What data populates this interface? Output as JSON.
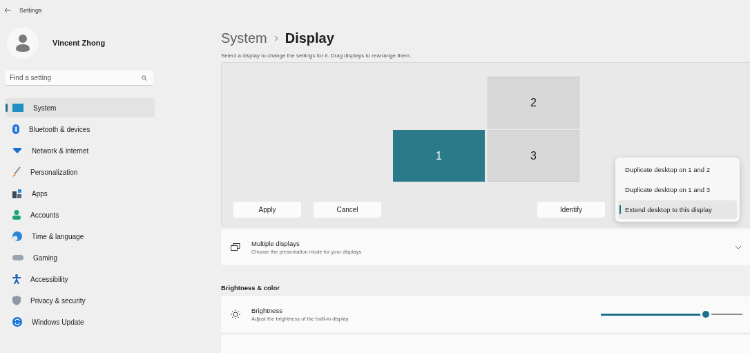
{
  "window": {
    "title": "Settings"
  },
  "profile": {
    "name": "Vincent Zhong"
  },
  "search": {
    "placeholder": "Find a setting"
  },
  "sidebar": {
    "items": [
      {
        "label": "System",
        "kind": "system",
        "selected": true
      },
      {
        "label": "Bluetooth & devices",
        "kind": "bluetooth",
        "selected": false
      },
      {
        "label": "Network & internet",
        "kind": "network",
        "selected": false
      },
      {
        "label": "Personalization",
        "kind": "brush",
        "selected": false
      },
      {
        "label": "Apps",
        "kind": "apps",
        "selected": false
      },
      {
        "label": "Accounts",
        "kind": "accounts",
        "selected": false
      },
      {
        "label": "Time & language",
        "kind": "time",
        "selected": false
      },
      {
        "label": "Gaming",
        "kind": "gaming",
        "selected": false
      },
      {
        "label": "Accessibility",
        "kind": "accessibility",
        "selected": false
      },
      {
        "label": "Privacy & security",
        "kind": "privacy",
        "selected": false
      },
      {
        "label": "Windows Update",
        "kind": "update",
        "selected": false
      }
    ]
  },
  "breadcrumb": {
    "parent": "System",
    "current": "Display"
  },
  "instructions": "Select a display to change the settings for it. Drag displays to rearrange them.",
  "displays": [
    {
      "label": "2",
      "selected": false
    },
    {
      "label": "1",
      "selected": true
    },
    {
      "label": "3",
      "selected": false
    }
  ],
  "buttons": [
    "Apply",
    "Cancel"
  ],
  "identify_button": "Identify",
  "mode_menu": [
    {
      "label": "Duplicate desktop on 1 and 2",
      "selected": false
    },
    {
      "label": "Duplicate desktop on 1 and 3",
      "selected": false
    },
    {
      "label": "Extend desktop to this display",
      "selected": true
    }
  ],
  "multiple_displays": {
    "title": "Multiple displays",
    "description": "Choose the presentation mode for your displays"
  },
  "section_heading": "Brightness & color",
  "brightness": {
    "title": "Brightness",
    "description": "Adjust the brightness of the built-in display",
    "level": 0.74
  }
}
